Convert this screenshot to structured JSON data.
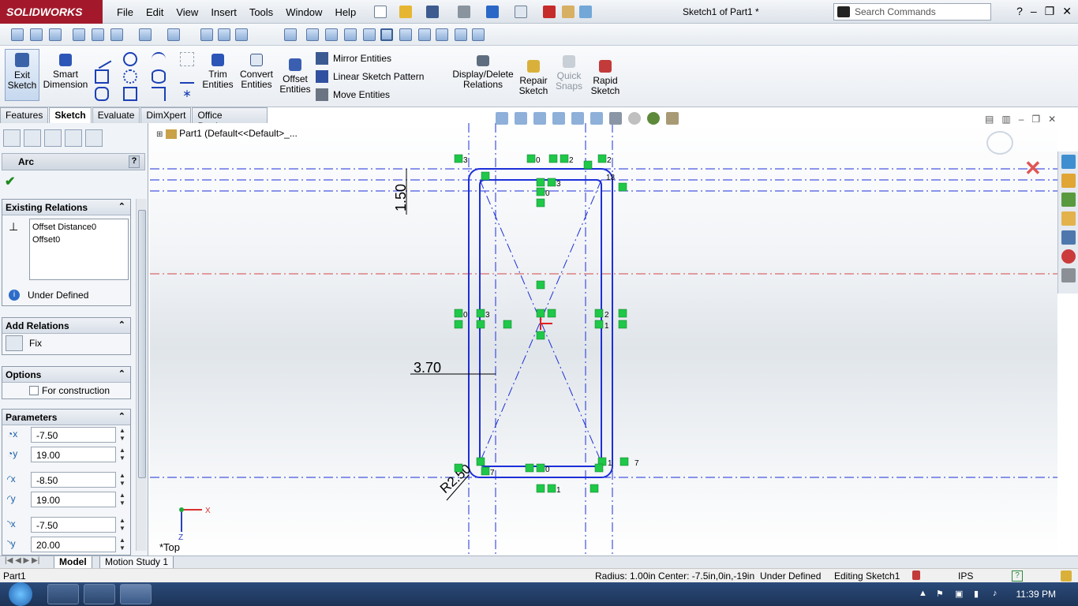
{
  "app": {
    "brand": "SOLIDWORKS",
    "document_title": "Sketch1 of Part1 *",
    "menus": [
      "File",
      "Edit",
      "View",
      "Insert",
      "Tools",
      "Window",
      "Help"
    ],
    "search_placeholder": "Search Commands",
    "window_controls": [
      "?",
      "–",
      "❐",
      "✕"
    ]
  },
  "command_manager": {
    "exit_sketch": "Exit Sketch",
    "smart_dimension": "Smart Dimension",
    "trim_entities": "Trim Entities",
    "convert_entities": "Convert Entities",
    "offset_entities": "Offset Entities",
    "mirror_entities": "Mirror Entities",
    "linear_sketch_pattern": "Linear Sketch Pattern",
    "move_entities": "Move Entities",
    "display_delete_relations": "Display/Delete Relations",
    "repair_sketch": "Repair Sketch",
    "quick_snaps": "Quick Snaps",
    "rapid_sketch": "Rapid Sketch"
  },
  "tabs": [
    "Features",
    "Sketch",
    "Evaluate",
    "DimXpert",
    "Office Products"
  ],
  "active_tab": "Sketch",
  "property_manager": {
    "title": "Arc",
    "help": "?",
    "existing_relations": {
      "header": "Existing Relations",
      "items": [
        "Offset Distance0",
        "Offset0"
      ],
      "status": "Under Defined"
    },
    "add_relations": {
      "header": "Add Relations",
      "items": [
        "Fix"
      ]
    },
    "options": {
      "header": "Options",
      "for_construction": "For construction"
    },
    "parameters": {
      "header": "Parameters",
      "center_x": "-7.50",
      "center_y": "19.00",
      "start_x": "-8.50",
      "start_y": "19.00",
      "end_x": "-7.50",
      "end_y": "20.00"
    }
  },
  "graphics": {
    "tree_root": "Part1  (Default<<Default>_...",
    "dimensions": {
      "vertical": "1.50",
      "horizontal": "3.70",
      "radius": "R2.50"
    },
    "relation_labels": [
      "3",
      "2",
      "0",
      "13",
      "3",
      "0",
      "2",
      "0",
      "3",
      "2",
      "1",
      "7",
      "0",
      "1",
      "1",
      "7"
    ],
    "triad_x": "X",
    "triad_z": "Z",
    "view_name": "*Top"
  },
  "bottom_tabs": [
    "Model",
    "Motion Study 1"
  ],
  "active_bottom_tab": "Model",
  "status_bar": {
    "document": "Part1",
    "geometry": "Radius: 1.00in  Center: -7.5in,0in,-19in",
    "definition": "Under Defined",
    "mode": "Editing Sketch1",
    "units": "IPS",
    "help": "?"
  },
  "taskbar": {
    "clock": "11:39 PM"
  },
  "colors": {
    "sketch_blue": "#1c2fd8",
    "relation_green": "#1fc848",
    "centerline_red": "#d04848",
    "brand_red": "#a3192b"
  }
}
